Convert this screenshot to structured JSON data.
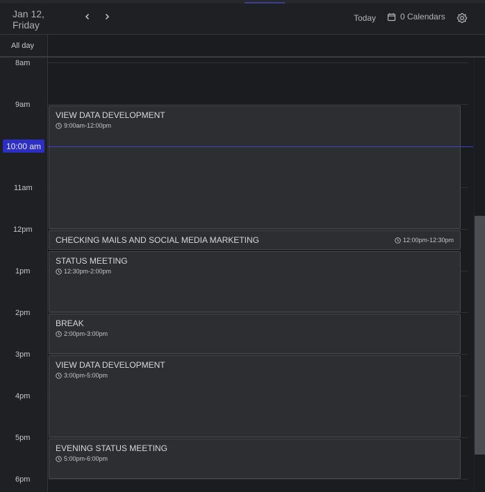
{
  "header": {
    "date_line1": "Jan 12,",
    "date_line2": "Friday",
    "today_label": "Today",
    "calendars_label": "0 Calendars",
    "prev_icon": "chevron-left-icon",
    "next_icon": "chevron-right-icon",
    "calendar_icon": "calendar-icon",
    "settings_icon": "gear-icon"
  },
  "all_day_label": "All day",
  "hours": [
    "8am",
    "9am",
    "11am",
    "12pm",
    "1pm",
    "2pm",
    "3pm",
    "4pm",
    "5pm",
    "6pm"
  ],
  "now_label": "10:00 am",
  "events": [
    {
      "title": "VIEW DATA DEVELOPMENT",
      "time": "9:00am-12:00pm"
    },
    {
      "title": "CHECKING MAILS AND SOCIAL MEDIA MARKETING",
      "time": "12:00pm-12:30pm"
    },
    {
      "title": "STATUS MEETING",
      "time": "12:30pm-2:00pm"
    },
    {
      "title": "BREAK",
      "time": "2:00pm-3:00pm"
    },
    {
      "title": "VIEW DATA DEVELOPMENT",
      "time": "3:00pm-5:00pm"
    },
    {
      "title": "EVENING STATUS MEETING",
      "time": "5:00pm-6:00pm"
    }
  ],
  "colors": {
    "accent": "#2c2ec4",
    "now_line": "#3a43c9",
    "event_bg": "#2c2e31",
    "event_border": "#46494d"
  }
}
